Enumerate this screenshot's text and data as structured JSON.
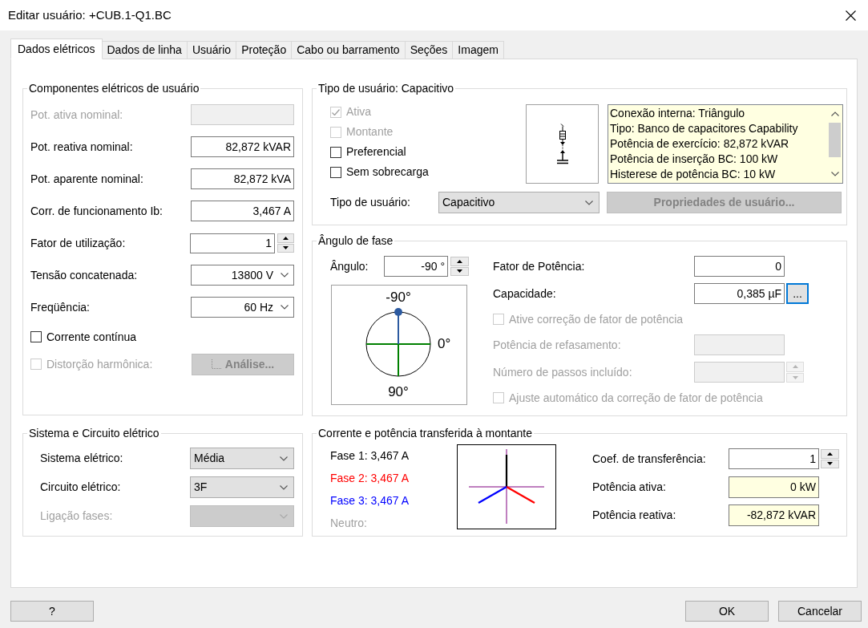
{
  "window": {
    "title": "Editar usuário: +CUB.1-Q1.BC"
  },
  "tabs": [
    {
      "label": "Dados elétricos",
      "selected": true
    },
    {
      "label": "Dados de linha",
      "selected": false
    },
    {
      "label": "Usuário",
      "selected": false
    },
    {
      "label": "Proteção",
      "selected": false
    },
    {
      "label": "Cabo ou barramento",
      "selected": false
    },
    {
      "label": "Seções",
      "selected": false
    },
    {
      "label": "Imagem",
      "selected": false
    }
  ],
  "electrical_components": {
    "title": "Componentes elétricos de usuário",
    "rows": [
      {
        "kind": "field",
        "label": "Pot. ativa nominal:",
        "disabled": true
      },
      {
        "kind": "field",
        "label": "Pot. reativa nominal:",
        "value": "82,872 kVAR",
        "disabled": false
      },
      {
        "kind": "field",
        "label": "Pot. aparente nominal:",
        "value": "82,872 kVA",
        "disabled": false
      },
      {
        "kind": "field",
        "label": "Corr. de funcionamento Ib:",
        "value": "3,467 A",
        "disabled": false
      },
      {
        "kind": "spinner",
        "label": "Fator de utilização:",
        "value": "1",
        "disabled": false
      },
      {
        "kind": "combo",
        "label": "Tensão concatenada:",
        "value": "13800 V",
        "disabled": false
      },
      {
        "kind": "combo",
        "label": "Freqüência:",
        "value": "60 Hz",
        "disabled": false
      },
      {
        "kind": "checkbox",
        "label": "Corrente contínua",
        "checked": false,
        "disabled": false
      },
      {
        "kind": "checkbox_button",
        "label": "Distorção harmônica:",
        "checked": false,
        "disabled": true,
        "button": {
          "label": "Análise...",
          "disabled": true
        }
      }
    ]
  },
  "user_type": {
    "title": "Tipo de usuário: Capacitivo",
    "options": [
      {
        "label": "Ativa",
        "checked": true,
        "disabled": true
      },
      {
        "label": "Montante",
        "checked": false,
        "disabled": true
      },
      {
        "label": "Preferencial",
        "checked": false,
        "disabled": false
      },
      {
        "label": "Sem sobrecarga",
        "checked": false,
        "disabled": false
      }
    ],
    "details": [
      "Conexão interna: Triângulo",
      "Tipo: Banco de capacitores Capability",
      "Potência de exercício: 82,872 kVAR",
      "Potência de inserção BC: 100 kW",
      "Histerese de potência BC: 10 kW"
    ],
    "type": {
      "label": "Tipo de usuário:",
      "value": "Capacitivo"
    },
    "properties_button": {
      "label": "Propriedades de usuário...",
      "disabled": true
    }
  },
  "phase_angle": {
    "title": "Ângulo de fase",
    "angle": {
      "label": "Ângulo:",
      "value": "-90 °"
    },
    "dial_labels": {
      "top": "-90°",
      "right": "0°",
      "bottom": "90°"
    },
    "rows": [
      {
        "kind": "field",
        "label": "Fator de Potência:",
        "value": "0",
        "disabled": false
      },
      {
        "kind": "field_button",
        "label": "Capacidade:",
        "value": "0,385 µF",
        "disabled": false,
        "button": {
          "label": "...",
          "focused": true
        }
      },
      {
        "kind": "checkbox",
        "label": "Ative correção de fator de potência",
        "checked": false,
        "disabled": true
      },
      {
        "kind": "field",
        "label": "Potência de refasamento:",
        "disabled": true
      },
      {
        "kind": "spinner",
        "label": "Número de passos incluído:",
        "disabled": true
      },
      {
        "kind": "checkbox",
        "label": "Ajuste automático da correção de fator de potência",
        "checked": false,
        "disabled": true
      }
    ]
  },
  "electrical_system": {
    "title": "Sistema e Circuito elétrico",
    "rows": [
      {
        "label": "Sistema elétrico:",
        "value": "Média",
        "disabled": false
      },
      {
        "label": "Circuito elétrico:",
        "value": "3F",
        "disabled": false
      },
      {
        "label": "Ligação fases:",
        "disabled": true
      }
    ]
  },
  "upstream_transfer": {
    "title": "Corrente e potência transferida à montante",
    "phases": [
      {
        "label": "Fase 1: 3,467 A",
        "color": "#000000"
      },
      {
        "label": "Fase 2: 3,467 A",
        "color": "#ff0000"
      },
      {
        "label": "Fase 3: 3,467 A",
        "color": "#0000ff"
      },
      {
        "label": "Neutro:",
        "color": "#a0a0a0"
      }
    ],
    "rows": [
      {
        "kind": "spinner",
        "label": "Coef. de transferência:",
        "value": "1"
      },
      {
        "kind": "readonly",
        "label": "Potência ativa:",
        "value": "0 kW"
      },
      {
        "kind": "readonly",
        "label": "Potência reativa:",
        "value": "-82,872 kVAR"
      }
    ]
  },
  "help_button": "?",
  "buttons": [
    "OK",
    "Cancelar"
  ]
}
